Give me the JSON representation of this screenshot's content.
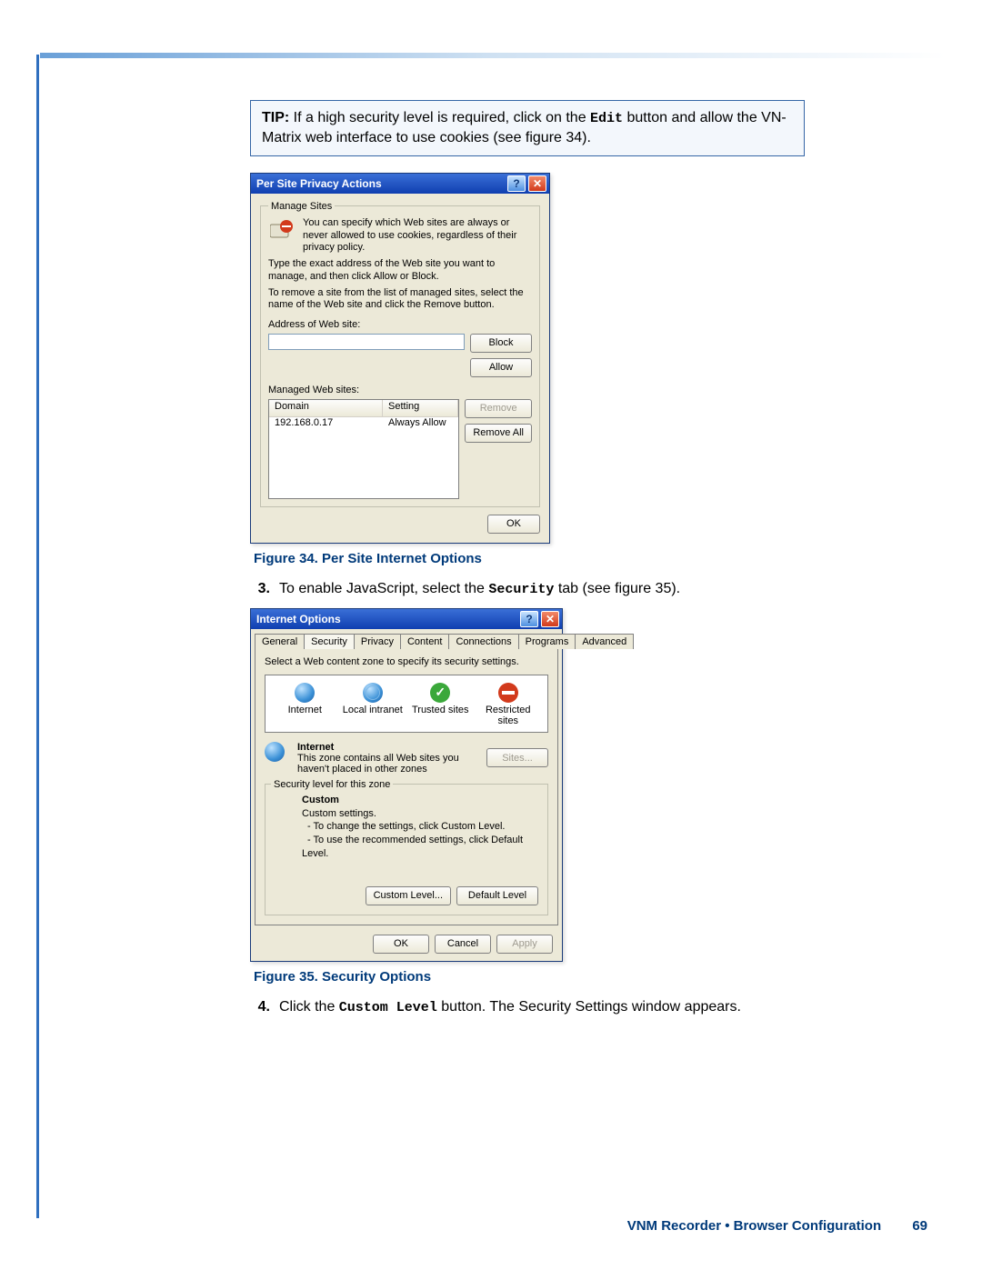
{
  "tip": {
    "label": "TIP:",
    "text1": "If a high security level is required, click on the ",
    "code1": "Edit",
    "text2": " button and allow the VN-Matrix web interface to use cookies (see figure 34)."
  },
  "dlg1": {
    "title": "Per Site Privacy Actions",
    "group_legend": "Manage Sites",
    "desc1": "You can specify which Web sites are always or never allowed to use cookies, regardless of their privacy policy.",
    "desc2": "Type the exact address of the Web site you want to manage, and then click Allow or Block.",
    "desc3": "To remove a site from the list of managed sites, select the name of the Web site and click the Remove button.",
    "addr_label": "Address of Web site:",
    "block": "Block",
    "allow": "Allow",
    "managed_label": "Managed Web sites:",
    "col_domain": "Domain",
    "col_setting": "Setting",
    "row_domain": "192.168.0.17",
    "row_setting": "Always Allow",
    "remove": "Remove",
    "remove_all": "Remove All",
    "ok": "OK"
  },
  "fig34": "Figure 34.    Per Site Internet Options",
  "step3": {
    "num": "3.",
    "t1": "To enable JavaScript, select the ",
    "code": "Security",
    "t2": " tab (see figure 35)."
  },
  "dlg2": {
    "title": "Internet Options",
    "tabs": [
      "General",
      "Security",
      "Privacy",
      "Content",
      "Connections",
      "Programs",
      "Advanced"
    ],
    "select_text": "Select a Web content zone to specify its security settings.",
    "zones": [
      "Internet",
      "Local intranet",
      "Trusted sites",
      "Restricted sites"
    ],
    "zone_internet": "Internet",
    "zone_desc": "This zone contains all Web sites you haven't placed in other zones",
    "sites_btn": "Sites...",
    "sec_level_legend": "Security level for this zone",
    "custom_title": "Custom",
    "custom_line1": "Custom settings.",
    "custom_line2": "- To change the settings, click Custom Level.",
    "custom_line3": "- To use the recommended settings, click Default Level.",
    "custom_level": "Custom Level...",
    "default_level": "Default Level",
    "ok": "OK",
    "cancel": "Cancel",
    "apply": "Apply"
  },
  "fig35": "Figure 35.    Security Options",
  "step4": {
    "num": "4.",
    "t1": "Click the ",
    "code": "Custom Level",
    "t2": " button. The Security Settings window appears."
  },
  "footer": {
    "text": "VNM Recorder • Browser Configuration",
    "page": "69"
  }
}
